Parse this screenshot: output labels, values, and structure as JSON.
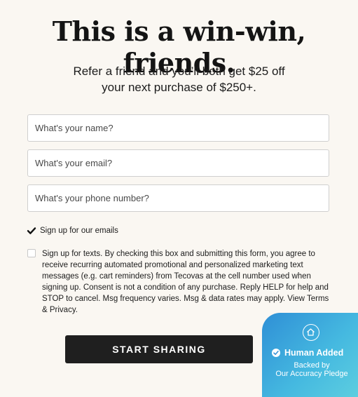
{
  "headline": "This is a win-win, friends.",
  "subhead": {
    "line1": "Refer a friend and you’ll both get $25 off",
    "line2": "your next purchase of $250+."
  },
  "form": {
    "name_placeholder": "What's your name?",
    "email_placeholder": "What's your email?",
    "phone_placeholder": "What's your phone number?",
    "emails_opt_in": {
      "label": "Sign up for our emails",
      "checked": true
    },
    "texts_opt_in": {
      "label": "Sign up for texts. By checking this box and submitting this form, you agree to receive recurring automated promotional and personalized marketing text messages (e.g. cart reminders) from Tecovas at the cell number used when signing up. Consent is not a condition of any purchase. Reply HELP for help and STOP to cancel. Msg frequency varies. Msg & data rates may apply. View Terms & Privacy.",
      "checked": false
    },
    "submit_label": "START SHARING"
  },
  "badge": {
    "icon": "home-icon",
    "title": "Human Added",
    "sub_line1": "Backed by",
    "sub_line2": "Our Accuracy Pledge"
  },
  "colors": {
    "background": "#faf7f2",
    "button": "#1f1f1f",
    "badge_gradient_start": "#2f8fd6",
    "badge_gradient_end": "#5fd0df"
  }
}
